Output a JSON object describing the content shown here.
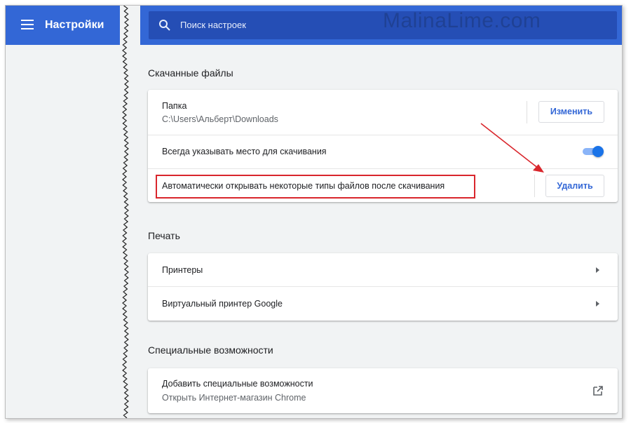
{
  "left_header": {
    "menu_icon": "hamburger-icon",
    "title": "Настройки"
  },
  "search": {
    "icon": "search-icon",
    "placeholder": "Поиск настроек"
  },
  "watermark": "MalinaLime.com",
  "downloads": {
    "title": "Скачанные файлы",
    "folder_label": "Папка",
    "folder_path": "C:\\Users\\Альберт\\Downloads",
    "change_button": "Изменить",
    "ask_location_label": "Всегда указывать место для скачивания",
    "ask_location_enabled": true,
    "auto_open_label": "Автоматически открывать некоторые типы файлов после скачивания",
    "delete_button": "Удалить"
  },
  "printing": {
    "title": "Печать",
    "items": [
      {
        "label": "Принтеры"
      },
      {
        "label": "Виртуальный принтер Google"
      }
    ]
  },
  "accessibility": {
    "title": "Специальные возможности",
    "add_label": "Добавить специальные возможности",
    "add_sub": "Открыть Интернет-магазин Chrome",
    "icon": "external-link-icon"
  },
  "colors": {
    "header_blue": "#3367d6",
    "search_bg": "#254eb5",
    "accent": "#1a73e8",
    "annotation_red": "#d9262c"
  }
}
